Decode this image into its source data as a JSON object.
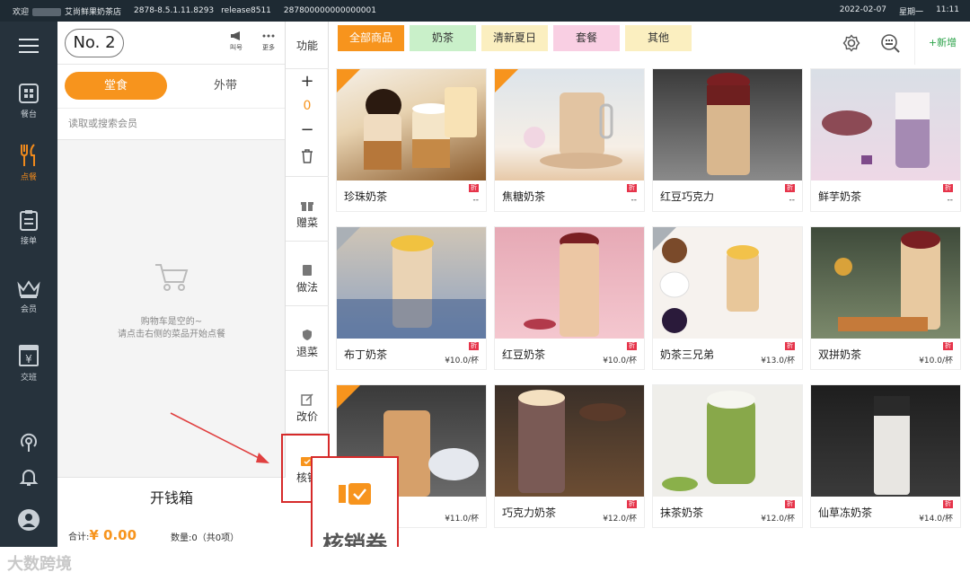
{
  "topbar": {
    "welcome": "欢迎",
    "shop": "艾尚鲜果奶茶店",
    "version": "2878-8.5.1.11.8293",
    "release": "release8511",
    "device_id": "287800000000000001",
    "date": "2022-02-07",
    "weekday": "星期一",
    "time": "11:11"
  },
  "sidebar": {
    "items": [
      {
        "label": "餐台",
        "icon": "table-icon"
      },
      {
        "label": "点餐",
        "icon": "fork-knife-icon"
      },
      {
        "label": "接单",
        "icon": "clipboard-icon"
      },
      {
        "label": "会员",
        "icon": "crown-icon"
      },
      {
        "label": "交班",
        "icon": "yen-box-icon"
      }
    ]
  },
  "cart": {
    "order_no": "No. 2",
    "call_label": "叫号",
    "more_label": "更多",
    "tab_dine_in": "堂食",
    "tab_takeout": "外带",
    "member_placeholder": "读取或搜索会员",
    "empty_line1": "购物车是空的~",
    "empty_line2": "请点击右侧的菜品开始点餐",
    "cash_drawer": "开钱箱",
    "total_label": "合计:",
    "total_value": "¥ 0.00",
    "qty_label": "数量:0（共0项）"
  },
  "functions": {
    "title": "功能",
    "plus": "+",
    "count": "0",
    "minus": "−",
    "gift": "赠菜",
    "method": "做法",
    "return": "退菜",
    "reprice": "改价",
    "verify": "核销"
  },
  "categories": [
    {
      "label": "全部商品",
      "bg": "#f7941d",
      "fg": "#ffffff"
    },
    {
      "label": "奶茶",
      "bg": "#c9f0c9",
      "fg": "#333333"
    },
    {
      "label": "清新夏日",
      "bg": "#fbefc0",
      "fg": "#333333"
    },
    {
      "label": "套餐",
      "bg": "#f9cfe3",
      "fg": "#333333"
    },
    {
      "label": "其他",
      "bg": "#fbefc0",
      "fg": "#333333"
    }
  ],
  "toolbar": {
    "add_label": "+新增"
  },
  "products": [
    {
      "name": "珍珠奶茶",
      "tag": "折",
      "price": "--"
    },
    {
      "name": "焦糖奶茶",
      "tag": "折",
      "price": "--"
    },
    {
      "name": "红豆巧克力",
      "tag": "折",
      "price": "--"
    },
    {
      "name": "鲜芋奶茶",
      "tag": "折",
      "price": "--"
    },
    {
      "name": "布丁奶茶",
      "tag": "折",
      "price": "¥10.0/杯"
    },
    {
      "name": "红豆奶茶",
      "tag": "折",
      "price": "¥10.0/杯"
    },
    {
      "name": "奶茶三兄弟",
      "tag": "折",
      "price": "¥13.0/杯"
    },
    {
      "name": "双拼奶茶",
      "tag": "折",
      "price": "¥10.0/杯"
    },
    {
      "name": "",
      "tag": "",
      "price": "¥11.0/杯"
    },
    {
      "name": "巧克力奶茶",
      "tag": "折",
      "price": "¥12.0/杯"
    },
    {
      "name": "抹茶奶茶",
      "tag": "折",
      "price": "¥12.0/杯"
    },
    {
      "name": "仙草冻奶茶",
      "tag": "折",
      "price": "¥14.0/杯"
    }
  ],
  "callout": {
    "label": "核销券"
  },
  "watermark": "大数跨境"
}
